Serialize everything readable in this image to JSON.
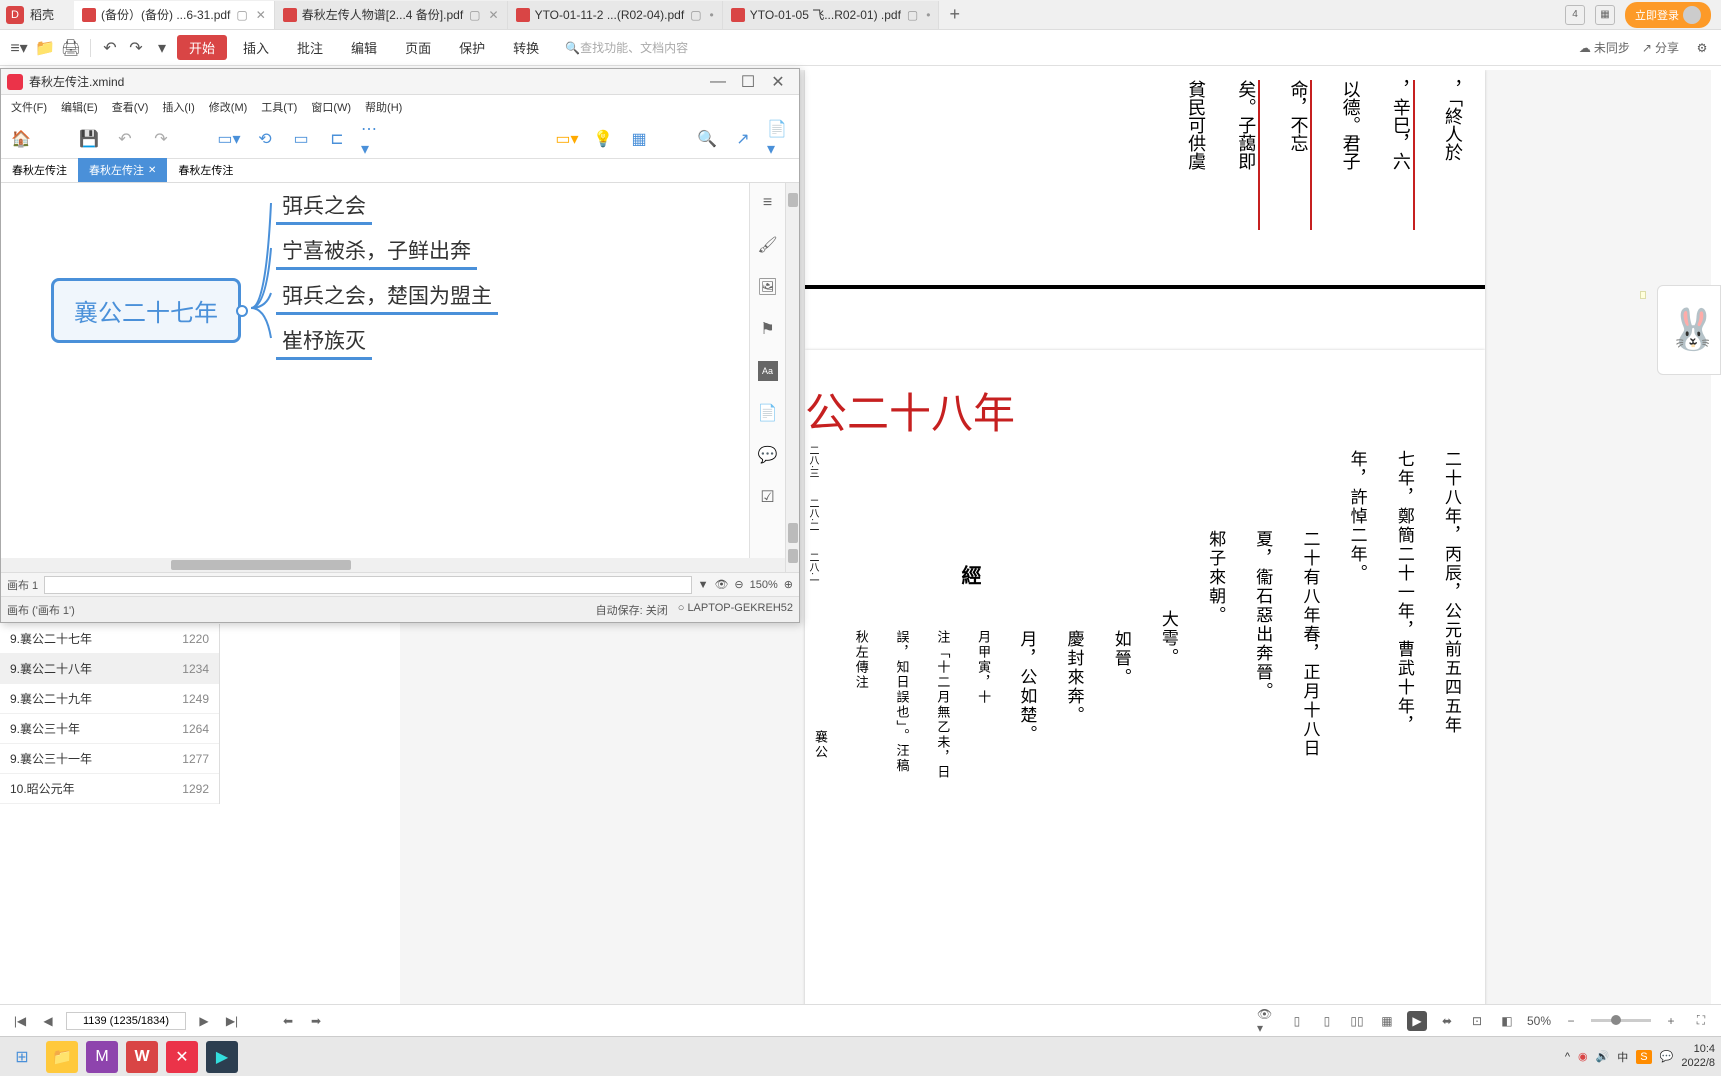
{
  "wps": {
    "brand": "稻壳",
    "tabs": [
      {
        "label": "(备份）(备份) ...6-31.pdf",
        "active": true
      },
      {
        "label": "春秋左传人物谱[2...4 备份].pdf",
        "active": false
      },
      {
        "label": "YTO-01-11-2 ...(R02-04).pdf",
        "active": false
      },
      {
        "label": "YTO-01-05 飞...R02-01) .pdf",
        "active": false
      }
    ],
    "login": "立即登录",
    "topbar_num": "4",
    "unsynced": "未同步",
    "share": "分享"
  },
  "menubar": {
    "start": "开始",
    "items": [
      "插入",
      "批注",
      "编辑",
      "页面",
      "保护",
      "转换"
    ],
    "search_placeholder": "查找功能、文档内容"
  },
  "xmind": {
    "title": "春秋左传注.xmind",
    "menus": [
      "文件(F)",
      "编辑(E)",
      "查看(V)",
      "插入(I)",
      "修改(M)",
      "工具(T)",
      "窗口(W)",
      "帮助(H)"
    ],
    "tabs": [
      "春秋左传注",
      "春秋左传注",
      "春秋左传注"
    ],
    "active_tab_index": 1,
    "root": "襄公二十七年",
    "children": [
      "弭兵之会",
      "宁喜被杀，子鲜出奔",
      "弭兵之会，楚国为盟主",
      "崔杼族灭"
    ],
    "footer_label": "画布 1",
    "footer_breadcrumb": "画布 ('画布 1')",
    "autosave": "自动保存: 关闭",
    "device": "LAPTOP-GEKREH52",
    "zoom": "150%"
  },
  "bookmarks": [
    {
      "label": "9.襄公二十七年",
      "page": "1220"
    },
    {
      "label": "9.襄公二十八年",
      "page": "1234",
      "active": true
    },
    {
      "label": "9.襄公二十九年",
      "page": "1249"
    },
    {
      "label": "9.襄公三十年",
      "page": "1264"
    },
    {
      "label": "9.襄公三十一年",
      "page": "1277"
    },
    {
      "label": "10.昭公元年",
      "page": "1292"
    }
  ],
  "pdf": {
    "top_cols": [
      "以德。君子",
      "命，不忘",
      "矣。子藹即",
      "貧民可供虞",
      "，辛巳，六",
      "，「終人於"
    ],
    "chapter_title": "公二十八年",
    "small_nums": [
      "二八·三",
      "二八·二",
      "二八·一"
    ],
    "jing": "經",
    "body_cols_1": "二十八年，丙辰，公元前五四五年",
    "body_cols_2": "七年，鄭簡二十一年，曹武十年，",
    "body_cols_3": "年，許悼二年。",
    "body_cols_4": "二十有八年春，正月十八日",
    "body_cols_5": "夏，衞石惡出奔晉。",
    "body_cols_6": "邾子來朝。",
    "body_cols_7": "大雩。",
    "body_cols_8": "如晉。",
    "body_cols_9": "慶封來奔。",
    "body_cols_10": "月，公如楚。",
    "body_cols_11": "月甲寅，十",
    "body_cols_12": "注「十二月無乙未，日",
    "body_cols_13": "誤，知日誤也」。汪稿",
    "body_cols_14": "秋左傳注",
    "body_cols_15": "襄公"
  },
  "statusbar": {
    "page_display": "1139 (1235/1834)",
    "zoom": "50%"
  },
  "taskbar": {
    "time": "10:4",
    "date": "2022/8"
  },
  "sticker_label": "中"
}
